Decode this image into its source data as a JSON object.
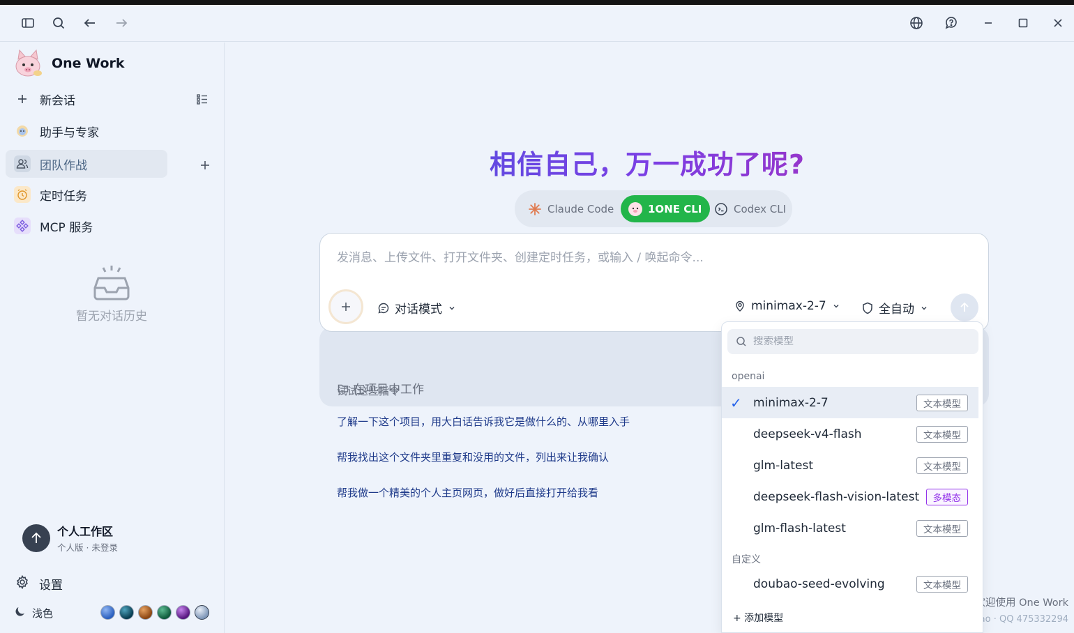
{
  "app": {
    "brand_name": "One Work"
  },
  "titlebar": {
    "icons": [
      "sidebar-toggle-icon",
      "search-icon",
      "back-arrow-icon",
      "forward-arrow-icon",
      "globe-icon",
      "help-icon",
      "minimize-icon",
      "maximize-icon",
      "close-icon"
    ]
  },
  "sidebar": {
    "items": [
      {
        "label": "新会话",
        "icon": "plus-icon"
      },
      {
        "label": "助手与专家",
        "icon": "assistant-icon"
      },
      {
        "label": "团队作战",
        "icon": "team-icon",
        "active": true
      },
      {
        "label": "定时任务",
        "icon": "alarm-icon"
      },
      {
        "label": "MCP 服务",
        "icon": "mcp-icon"
      }
    ],
    "empty_history": "暂无对话历史",
    "workspace": {
      "title": "个人工作区",
      "subtitle": "个人版 · 未登录"
    },
    "settings_label": "设置",
    "theme_label": "浅色",
    "theme_swatches": [
      "#3a6fd0",
      "#0b5f78",
      "#b5651d",
      "#1e7a57",
      "#7a2fa6",
      "#a7b8cf"
    ]
  },
  "main": {
    "headline": "相信自己，万一成功了呢?",
    "agents": [
      {
        "label": "Claude Code",
        "icon": "claude-sparkle-icon"
      },
      {
        "label": "1ONE CLI",
        "icon": "pig-icon",
        "selected": true
      },
      {
        "label": "Codex CLI",
        "icon": "codex-icon"
      }
    ],
    "composer": {
      "placeholder": "发消息、上传文件、打开文件夹、创建定时任务，或输入 / 唤起命令...",
      "mode_label": "对话模式",
      "model_label": "minimax-2-7",
      "auto_label": "全自动",
      "project_label": "在项目中工作"
    },
    "suggestions_title": "试试这些指令",
    "suggestions": [
      "了解一下这个项目，用大白话告诉我它是做什么的、从哪里入手",
      "帮我找出这个文件夹里重复和没用的文件，列出来让我确认",
      "帮我做一个精美的个人主页网页，做好后直接打开给我看"
    ],
    "welcome_line1": "欢迎使用 One Work",
    "welcome_line2": "ao · QQ 475332294"
  },
  "model_dropdown": {
    "search_placeholder": "搜索模型",
    "groups": [
      {
        "name": "openai",
        "models": [
          {
            "name": "minimax-2-7",
            "tag": "文本模型",
            "selected": true
          },
          {
            "name": "deepseek-v4-flash",
            "tag": "文本模型"
          },
          {
            "name": "glm-latest",
            "tag": "文本模型"
          },
          {
            "name": "deepseek-flash-vision-latest",
            "tag": "多模态"
          },
          {
            "name": "glm-flash-latest",
            "tag": "文本模型"
          }
        ]
      },
      {
        "name": "自定义",
        "models": [
          {
            "name": "doubao-seed-evolving",
            "tag": "文本模型"
          }
        ]
      }
    ],
    "add_label": "+ 添加模型",
    "checkmark": "✓"
  }
}
